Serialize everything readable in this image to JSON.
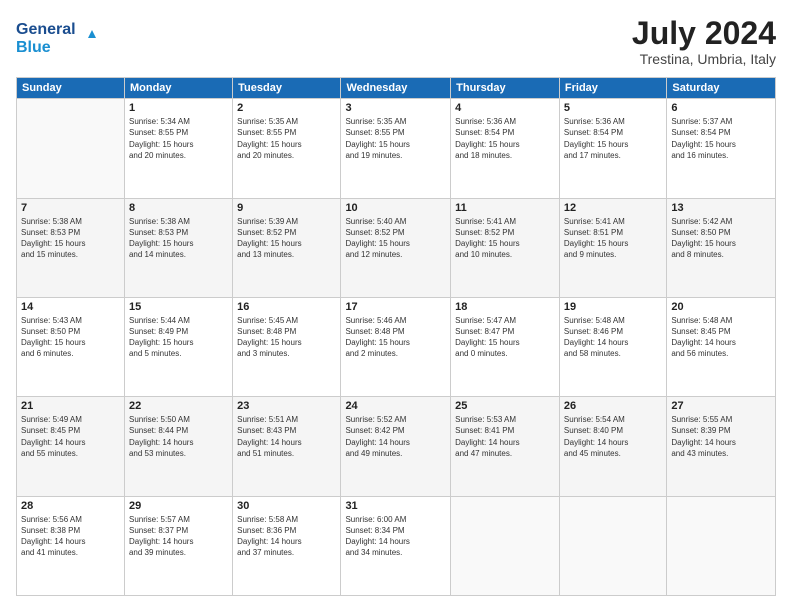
{
  "header": {
    "logo_line1": "General",
    "logo_line2": "Blue",
    "month_year": "July 2024",
    "location": "Trestina, Umbria, Italy"
  },
  "days_of_week": [
    "Sunday",
    "Monday",
    "Tuesday",
    "Wednesday",
    "Thursday",
    "Friday",
    "Saturday"
  ],
  "weeks": [
    [
      {
        "day": "",
        "detail": ""
      },
      {
        "day": "1",
        "detail": "Sunrise: 5:34 AM\nSunset: 8:55 PM\nDaylight: 15 hours\nand 20 minutes."
      },
      {
        "day": "2",
        "detail": "Sunrise: 5:35 AM\nSunset: 8:55 PM\nDaylight: 15 hours\nand 20 minutes."
      },
      {
        "day": "3",
        "detail": "Sunrise: 5:35 AM\nSunset: 8:55 PM\nDaylight: 15 hours\nand 19 minutes."
      },
      {
        "day": "4",
        "detail": "Sunrise: 5:36 AM\nSunset: 8:54 PM\nDaylight: 15 hours\nand 18 minutes."
      },
      {
        "day": "5",
        "detail": "Sunrise: 5:36 AM\nSunset: 8:54 PM\nDaylight: 15 hours\nand 17 minutes."
      },
      {
        "day": "6",
        "detail": "Sunrise: 5:37 AM\nSunset: 8:54 PM\nDaylight: 15 hours\nand 16 minutes."
      }
    ],
    [
      {
        "day": "7",
        "detail": "Sunrise: 5:38 AM\nSunset: 8:53 PM\nDaylight: 15 hours\nand 15 minutes."
      },
      {
        "day": "8",
        "detail": "Sunrise: 5:38 AM\nSunset: 8:53 PM\nDaylight: 15 hours\nand 14 minutes."
      },
      {
        "day": "9",
        "detail": "Sunrise: 5:39 AM\nSunset: 8:52 PM\nDaylight: 15 hours\nand 13 minutes."
      },
      {
        "day": "10",
        "detail": "Sunrise: 5:40 AM\nSunset: 8:52 PM\nDaylight: 15 hours\nand 12 minutes."
      },
      {
        "day": "11",
        "detail": "Sunrise: 5:41 AM\nSunset: 8:52 PM\nDaylight: 15 hours\nand 10 minutes."
      },
      {
        "day": "12",
        "detail": "Sunrise: 5:41 AM\nSunset: 8:51 PM\nDaylight: 15 hours\nand 9 minutes."
      },
      {
        "day": "13",
        "detail": "Sunrise: 5:42 AM\nSunset: 8:50 PM\nDaylight: 15 hours\nand 8 minutes."
      }
    ],
    [
      {
        "day": "14",
        "detail": "Sunrise: 5:43 AM\nSunset: 8:50 PM\nDaylight: 15 hours\nand 6 minutes."
      },
      {
        "day": "15",
        "detail": "Sunrise: 5:44 AM\nSunset: 8:49 PM\nDaylight: 15 hours\nand 5 minutes."
      },
      {
        "day": "16",
        "detail": "Sunrise: 5:45 AM\nSunset: 8:48 PM\nDaylight: 15 hours\nand 3 minutes."
      },
      {
        "day": "17",
        "detail": "Sunrise: 5:46 AM\nSunset: 8:48 PM\nDaylight: 15 hours\nand 2 minutes."
      },
      {
        "day": "18",
        "detail": "Sunrise: 5:47 AM\nSunset: 8:47 PM\nDaylight: 15 hours\nand 0 minutes."
      },
      {
        "day": "19",
        "detail": "Sunrise: 5:48 AM\nSunset: 8:46 PM\nDaylight: 14 hours\nand 58 minutes."
      },
      {
        "day": "20",
        "detail": "Sunrise: 5:48 AM\nSunset: 8:45 PM\nDaylight: 14 hours\nand 56 minutes."
      }
    ],
    [
      {
        "day": "21",
        "detail": "Sunrise: 5:49 AM\nSunset: 8:45 PM\nDaylight: 14 hours\nand 55 minutes."
      },
      {
        "day": "22",
        "detail": "Sunrise: 5:50 AM\nSunset: 8:44 PM\nDaylight: 14 hours\nand 53 minutes."
      },
      {
        "day": "23",
        "detail": "Sunrise: 5:51 AM\nSunset: 8:43 PM\nDaylight: 14 hours\nand 51 minutes."
      },
      {
        "day": "24",
        "detail": "Sunrise: 5:52 AM\nSunset: 8:42 PM\nDaylight: 14 hours\nand 49 minutes."
      },
      {
        "day": "25",
        "detail": "Sunrise: 5:53 AM\nSunset: 8:41 PM\nDaylight: 14 hours\nand 47 minutes."
      },
      {
        "day": "26",
        "detail": "Sunrise: 5:54 AM\nSunset: 8:40 PM\nDaylight: 14 hours\nand 45 minutes."
      },
      {
        "day": "27",
        "detail": "Sunrise: 5:55 AM\nSunset: 8:39 PM\nDaylight: 14 hours\nand 43 minutes."
      }
    ],
    [
      {
        "day": "28",
        "detail": "Sunrise: 5:56 AM\nSunset: 8:38 PM\nDaylight: 14 hours\nand 41 minutes."
      },
      {
        "day": "29",
        "detail": "Sunrise: 5:57 AM\nSunset: 8:37 PM\nDaylight: 14 hours\nand 39 minutes."
      },
      {
        "day": "30",
        "detail": "Sunrise: 5:58 AM\nSunset: 8:36 PM\nDaylight: 14 hours\nand 37 minutes."
      },
      {
        "day": "31",
        "detail": "Sunrise: 6:00 AM\nSunset: 8:34 PM\nDaylight: 14 hours\nand 34 minutes."
      },
      {
        "day": "",
        "detail": ""
      },
      {
        "day": "",
        "detail": ""
      },
      {
        "day": "",
        "detail": ""
      }
    ]
  ]
}
